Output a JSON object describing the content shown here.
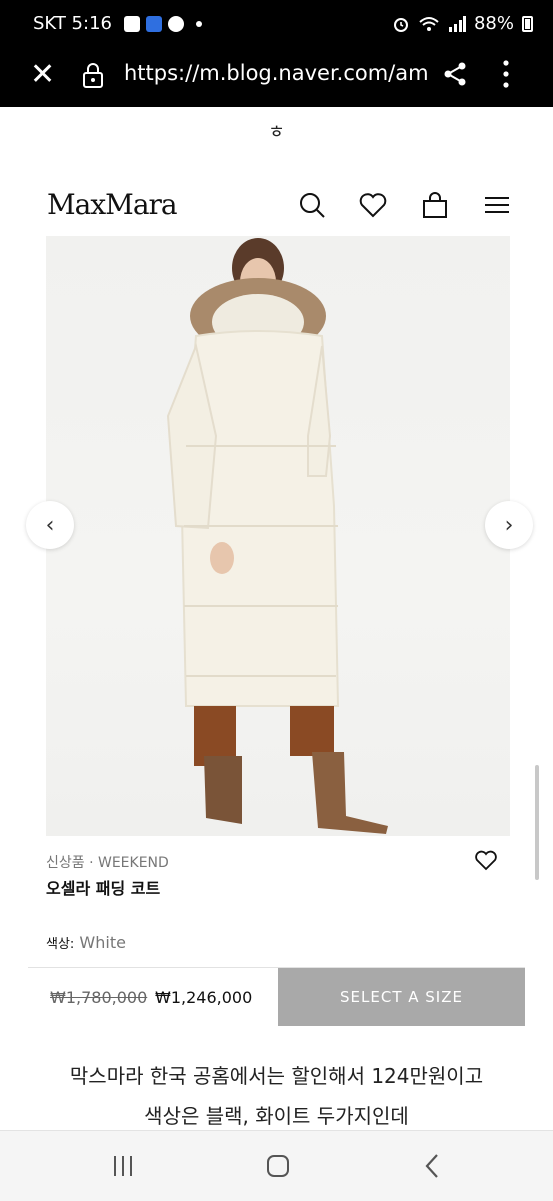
{
  "status_bar": {
    "carrier_time": "SKT 5:16",
    "battery": "88%"
  },
  "url_bar": {
    "url": "https://m.blog.naver.com/am"
  },
  "site": {
    "top_char": "ㅎ",
    "logo": "MaxMara"
  },
  "product": {
    "meta": "신상품 · WEEKEND",
    "name": "오셀라 패딩 코트",
    "color_label": "색상:",
    "color_value": "White",
    "old_price": "₩1,780,000",
    "new_price": "₩1,246,000",
    "select_size": "SELECT A SIZE"
  },
  "blog": {
    "line1": "막스마라 한국 공홈에서는 할인해서 124만원이고",
    "line2": "색상은 블랙, 화이트 두가지인데"
  },
  "icons": {
    "close": "close-icon",
    "lock": "lock-icon",
    "share": "share-icon",
    "menu": "more-vertical-icon",
    "search": "search-icon",
    "wishlist": "heart-icon",
    "bag": "bag-icon",
    "hamburger": "hamburger-icon"
  },
  "colors": {
    "select_button_bg": "#a9a9a9",
    "topbar_bg": "#000000"
  }
}
